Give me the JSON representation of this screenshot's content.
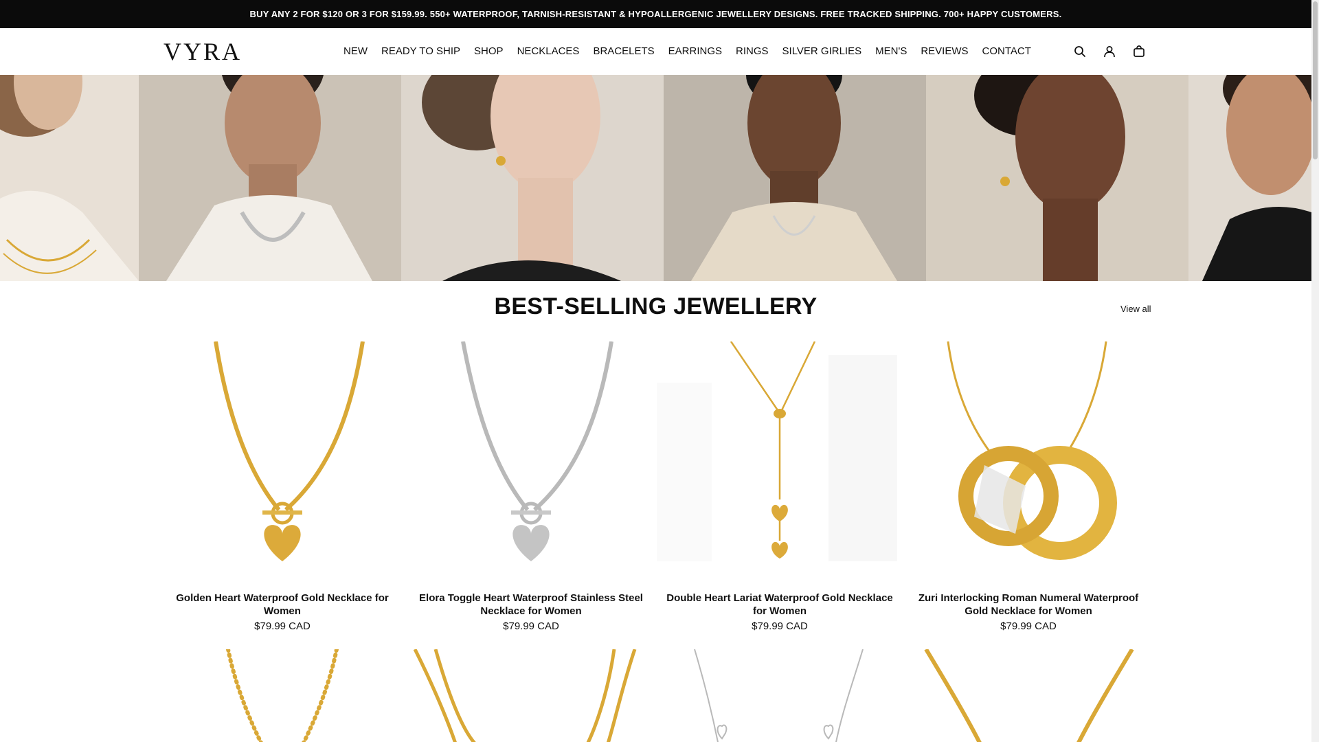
{
  "announcement": "BUY ANY 2 FOR $120 OR 3 FOR $159.99. 550+ WATERPROOF, TARNISH-RESISTANT & HYPOALLERGENIC JEWELLERY DESIGNS. FREE TRACKED SHIPPING. 700+ HAPPY CUSTOMERS.",
  "brand": "VYRA",
  "nav": [
    "NEW",
    "READY TO SHIP",
    "SHOP",
    "NECKLACES",
    "BRACELETS",
    "EARRINGS",
    "RINGS",
    "SILVER GIRLIES",
    "MEN'S",
    "REVIEWS",
    "CONTACT"
  ],
  "icons": [
    "search-icon",
    "account-icon",
    "cart-icon"
  ],
  "section": {
    "title": "BEST-SELLING JEWELLERY",
    "view_all": "View all"
  },
  "products": [
    {
      "name": "Golden Heart Waterproof Gold Necklace for Women",
      "price": "$79.99 CAD"
    },
    {
      "name": "Elora Toggle Heart Waterproof Stainless Steel Necklace for Women",
      "price": "$79.99 CAD"
    },
    {
      "name": "Double Heart Lariat Waterproof Gold Necklace for Women",
      "price": "$79.99 CAD"
    },
    {
      "name": "Zuri Interlocking Roman Numeral Waterproof Gold Necklace for Women",
      "price": "$79.99 CAD"
    }
  ],
  "colors": {
    "announcement_bg": "#0b0b0b",
    "gold": "#d9a836",
    "silver": "#b9b9b9"
  }
}
